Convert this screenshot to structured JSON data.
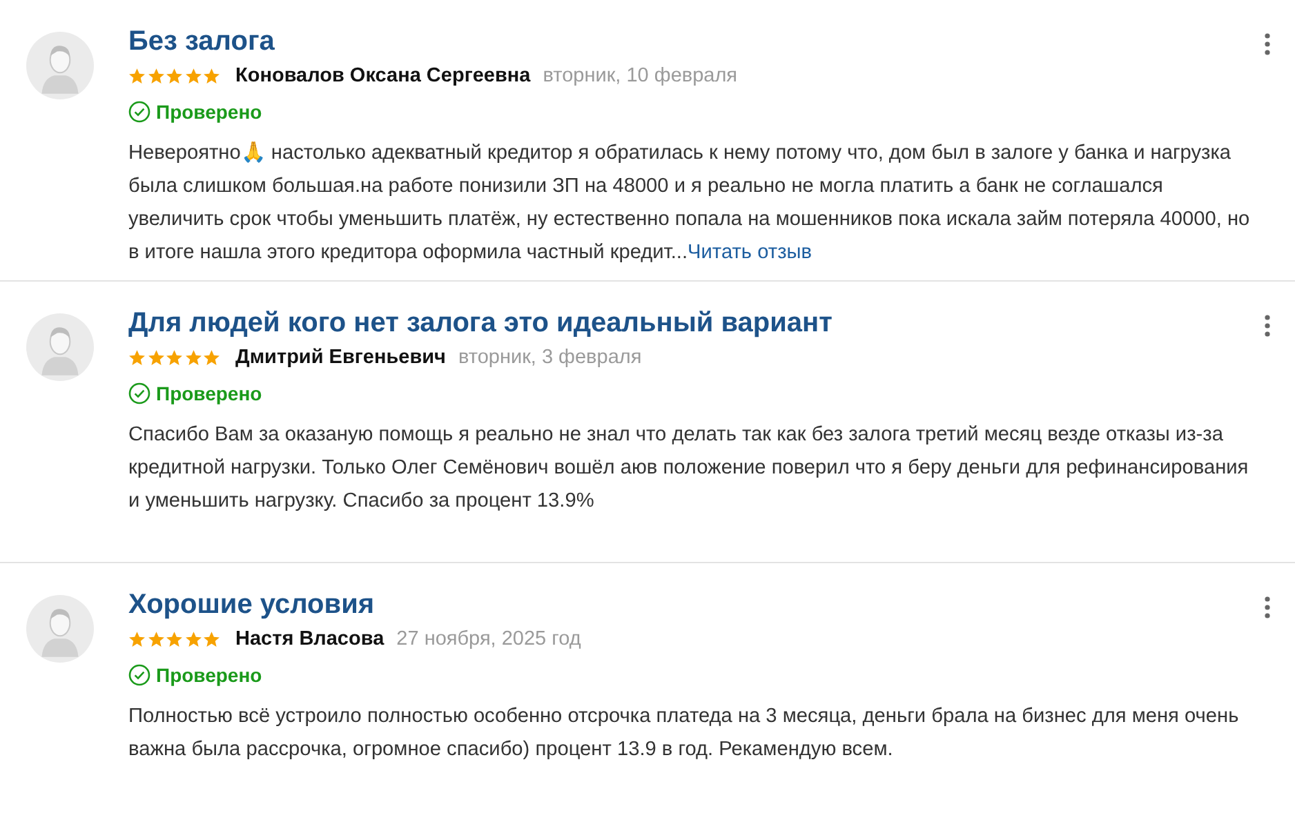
{
  "reviews": [
    {
      "title": "Без залога",
      "stars": 5,
      "author": "Коновалов Оксана Сергеевна",
      "date": "вторник, 10 февраля",
      "verified": true,
      "verified_label": "Проверено",
      "text": "Невероятно🙏 настолько адекватный кредитор я обратилась к нему потому что, дом был в залоге у банка и нагрузка была слишком большая.на работе понизили ЗП на 48000 и я реально не могла платить а банк не соглашался увеличить срок чтобы уменьшить платёж, ну естественно попала на мошенников пока искала займ потеряла 40000, но в итоге нашла этого кредитора оформила частный кредит...",
      "read_more": "Читать отзыв"
    },
    {
      "title": "Для людей кого нет залога это идеальный вариант",
      "stars": 5,
      "author": "Дмитрий Евгеньевич",
      "date": "вторник, 3 февраля",
      "verified": true,
      "verified_label": "Проверено",
      "text": "Спасибо Вам за оказаную помощь я реально не знал что делать так как без залога третий месяц везде отказы из-за кредитной нагрузки. Только Олег Семёнович вошёл аюв положение поверил что я беру деньги для рефинансирования и уменьшить нагрузку. Спасибо за процент 13.9%"
    },
    {
      "title": "Хорошие условия",
      "stars": 5,
      "author": "Настя Власова",
      "date": "27 ноября, 2025 год",
      "verified": true,
      "verified_label": "Проверено",
      "text": "Полностью всё устроило полностью особенно отсрочка платеда на 3 месяца, деньги брала на бизнес для меня очень важна была рассрочка, огромное спасибо) процент 13.9 в год. Рекамендую всем."
    }
  ]
}
